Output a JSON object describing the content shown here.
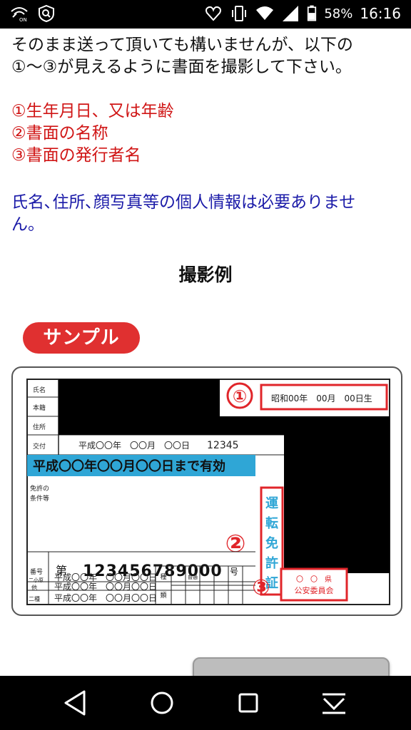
{
  "status_bar": {
    "battery_percent": "58%",
    "time": "16:16"
  },
  "content": {
    "intro_line1": "そのまま送って頂いても構いませんが、以下の",
    "intro_line2": "①〜③が見えるように書面を撮影して下さい。",
    "required_items": [
      "①生年月日、又は年齢",
      "②書面の名称",
      "③書面の発行者名"
    ],
    "not_needed_line1": "氏名､住所､顔写真等の個人情報は必要ありませ",
    "not_needed_line2": "ん。",
    "example_title": "撮影例"
  },
  "sample": {
    "badge": "サンプル",
    "rows": {
      "name": "氏名",
      "honseki": "本籍",
      "address": "住所",
      "issued": "交付",
      "conditions_1": "免許の",
      "conditions_2": "条件等",
      "number_label": "番号",
      "nishoutei": "二小原",
      "other": "他",
      "nishu": "二種"
    },
    "birth_date": "昭和00年　00月　00日生",
    "issue_date": "平成〇〇年　〇〇月　〇〇日",
    "issue_number": "12345",
    "valid_until": "平成〇〇年〇〇月〇〇日まで有効",
    "number_prefix": "第",
    "license_number": "123456789000",
    "number_suffix": "号",
    "sub_date": "平成〇〇年　〇〇月〇〇日",
    "kind_label_1": "種",
    "kind_label_2": "類",
    "kind_sub": "普通",
    "document_name": [
      "運",
      "転",
      "免",
      "許",
      "証"
    ],
    "issuer_1": "〇　〇　県",
    "issuer_2": "公安委員会",
    "markers": [
      "①",
      "②",
      "③"
    ]
  },
  "colors": {
    "red": "#d01515",
    "blue": "#1a1aa8",
    "card_cyan": "#2fa6d6",
    "marker_red": "#e0252a"
  }
}
